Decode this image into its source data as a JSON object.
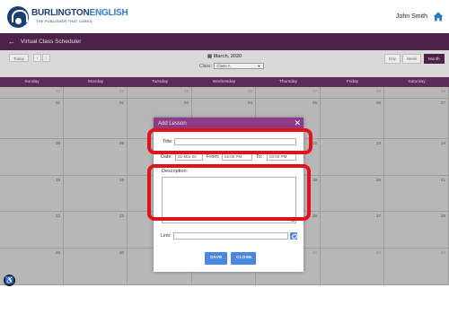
{
  "header": {
    "logo_bold": "BURLINGTON",
    "logo_light": "ENGLISH",
    "logo_tagline": "THE PUBLISHER THAT CARES",
    "user_name": "John Smith",
    "home_icon": "home-icon"
  },
  "app": {
    "title": "Virtual Class Scheduler",
    "back_icon": "arrow-left-icon"
  },
  "toolbar": {
    "today_label": "Today",
    "prev_label": "‹",
    "next_label": "›",
    "calendar_title": "March, 2020",
    "calendar_icon": "calendar-icon",
    "class_label": "Class:",
    "class_value": "Class A",
    "views": [
      "Day",
      "Week",
      "Month"
    ],
    "active_view": "Month"
  },
  "calendar": {
    "days": [
      "Sunday",
      "Monday",
      "Tuesday",
      "Wednesday",
      "Thursday",
      "Friday",
      "Saturday"
    ],
    "weeks": [
      [
        "23",
        "24",
        "25",
        "26",
        "27",
        "28",
        "29"
      ],
      [
        "01",
        "02",
        "03",
        "04",
        "05",
        "06",
        "07"
      ],
      [
        "08",
        "09",
        "10",
        "11",
        "12",
        "13",
        "14"
      ],
      [
        "15",
        "16",
        "17",
        "18",
        "19",
        "20",
        "21"
      ],
      [
        "22",
        "23",
        "24",
        "25",
        "26",
        "27",
        "28"
      ],
      [
        "29",
        "30",
        "31",
        "01",
        "02",
        "03",
        "04"
      ]
    ]
  },
  "modal": {
    "title": "Add Lesson",
    "close_label": "✕",
    "title_label": "Title:",
    "title_value": "",
    "date_label": "Date:",
    "date_value": "31-Mar-20",
    "from_label": "From:",
    "from_value": "02:00 PM",
    "to_label": "To:",
    "to_value": "03:00 PM",
    "description_label": "Description:",
    "description_value": "",
    "link_label": "Link:",
    "link_value": "",
    "link_icon": "link-icon",
    "save_label": "SAVE",
    "close_button_label": "CLOSE"
  },
  "colors": {
    "header_bar": "#4c2248",
    "day_header": "#5c2b58",
    "modal_header": "#8d3b87",
    "button": "#4b86e0",
    "highlight": "#e1121b",
    "overlay_cell": "#b7b7b7"
  },
  "accessibility_icon": "accessibility-icon"
}
